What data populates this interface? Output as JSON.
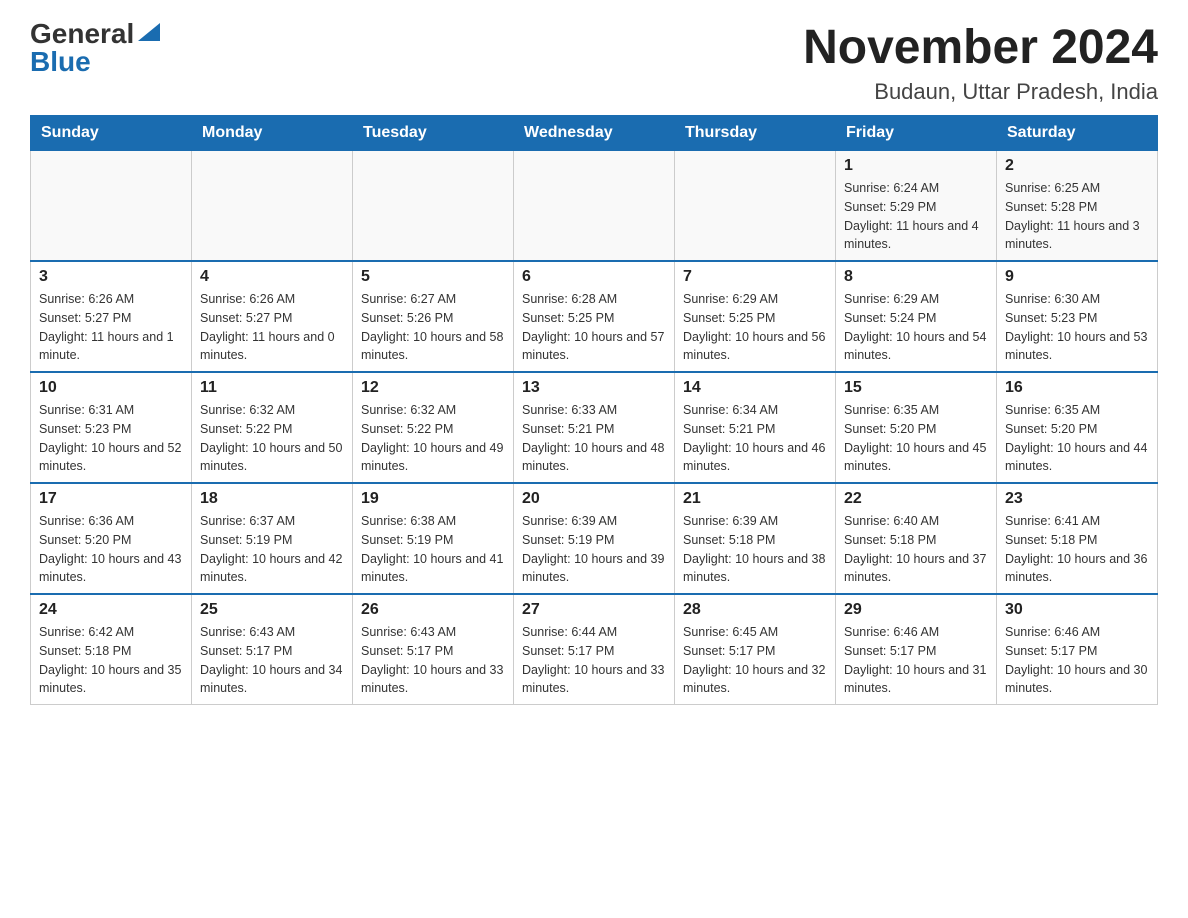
{
  "header": {
    "logo": {
      "general": "General",
      "blue": "Blue"
    },
    "title": "November 2024",
    "subtitle": "Budaun, Uttar Pradesh, India"
  },
  "days_of_week": [
    "Sunday",
    "Monday",
    "Tuesday",
    "Wednesday",
    "Thursday",
    "Friday",
    "Saturday"
  ],
  "weeks": [
    [
      {
        "day": "",
        "info": ""
      },
      {
        "day": "",
        "info": ""
      },
      {
        "day": "",
        "info": ""
      },
      {
        "day": "",
        "info": ""
      },
      {
        "day": "",
        "info": ""
      },
      {
        "day": "1",
        "info": "Sunrise: 6:24 AM\nSunset: 5:29 PM\nDaylight: 11 hours and 4 minutes."
      },
      {
        "day": "2",
        "info": "Sunrise: 6:25 AM\nSunset: 5:28 PM\nDaylight: 11 hours and 3 minutes."
      }
    ],
    [
      {
        "day": "3",
        "info": "Sunrise: 6:26 AM\nSunset: 5:27 PM\nDaylight: 11 hours and 1 minute."
      },
      {
        "day": "4",
        "info": "Sunrise: 6:26 AM\nSunset: 5:27 PM\nDaylight: 11 hours and 0 minutes."
      },
      {
        "day": "5",
        "info": "Sunrise: 6:27 AM\nSunset: 5:26 PM\nDaylight: 10 hours and 58 minutes."
      },
      {
        "day": "6",
        "info": "Sunrise: 6:28 AM\nSunset: 5:25 PM\nDaylight: 10 hours and 57 minutes."
      },
      {
        "day": "7",
        "info": "Sunrise: 6:29 AM\nSunset: 5:25 PM\nDaylight: 10 hours and 56 minutes."
      },
      {
        "day": "8",
        "info": "Sunrise: 6:29 AM\nSunset: 5:24 PM\nDaylight: 10 hours and 54 minutes."
      },
      {
        "day": "9",
        "info": "Sunrise: 6:30 AM\nSunset: 5:23 PM\nDaylight: 10 hours and 53 minutes."
      }
    ],
    [
      {
        "day": "10",
        "info": "Sunrise: 6:31 AM\nSunset: 5:23 PM\nDaylight: 10 hours and 52 minutes."
      },
      {
        "day": "11",
        "info": "Sunrise: 6:32 AM\nSunset: 5:22 PM\nDaylight: 10 hours and 50 minutes."
      },
      {
        "day": "12",
        "info": "Sunrise: 6:32 AM\nSunset: 5:22 PM\nDaylight: 10 hours and 49 minutes."
      },
      {
        "day": "13",
        "info": "Sunrise: 6:33 AM\nSunset: 5:21 PM\nDaylight: 10 hours and 48 minutes."
      },
      {
        "day": "14",
        "info": "Sunrise: 6:34 AM\nSunset: 5:21 PM\nDaylight: 10 hours and 46 minutes."
      },
      {
        "day": "15",
        "info": "Sunrise: 6:35 AM\nSunset: 5:20 PM\nDaylight: 10 hours and 45 minutes."
      },
      {
        "day": "16",
        "info": "Sunrise: 6:35 AM\nSunset: 5:20 PM\nDaylight: 10 hours and 44 minutes."
      }
    ],
    [
      {
        "day": "17",
        "info": "Sunrise: 6:36 AM\nSunset: 5:20 PM\nDaylight: 10 hours and 43 minutes."
      },
      {
        "day": "18",
        "info": "Sunrise: 6:37 AM\nSunset: 5:19 PM\nDaylight: 10 hours and 42 minutes."
      },
      {
        "day": "19",
        "info": "Sunrise: 6:38 AM\nSunset: 5:19 PM\nDaylight: 10 hours and 41 minutes."
      },
      {
        "day": "20",
        "info": "Sunrise: 6:39 AM\nSunset: 5:19 PM\nDaylight: 10 hours and 39 minutes."
      },
      {
        "day": "21",
        "info": "Sunrise: 6:39 AM\nSunset: 5:18 PM\nDaylight: 10 hours and 38 minutes."
      },
      {
        "day": "22",
        "info": "Sunrise: 6:40 AM\nSunset: 5:18 PM\nDaylight: 10 hours and 37 minutes."
      },
      {
        "day": "23",
        "info": "Sunrise: 6:41 AM\nSunset: 5:18 PM\nDaylight: 10 hours and 36 minutes."
      }
    ],
    [
      {
        "day": "24",
        "info": "Sunrise: 6:42 AM\nSunset: 5:18 PM\nDaylight: 10 hours and 35 minutes."
      },
      {
        "day": "25",
        "info": "Sunrise: 6:43 AM\nSunset: 5:17 PM\nDaylight: 10 hours and 34 minutes."
      },
      {
        "day": "26",
        "info": "Sunrise: 6:43 AM\nSunset: 5:17 PM\nDaylight: 10 hours and 33 minutes."
      },
      {
        "day": "27",
        "info": "Sunrise: 6:44 AM\nSunset: 5:17 PM\nDaylight: 10 hours and 33 minutes."
      },
      {
        "day": "28",
        "info": "Sunrise: 6:45 AM\nSunset: 5:17 PM\nDaylight: 10 hours and 32 minutes."
      },
      {
        "day": "29",
        "info": "Sunrise: 6:46 AM\nSunset: 5:17 PM\nDaylight: 10 hours and 31 minutes."
      },
      {
        "day": "30",
        "info": "Sunrise: 6:46 AM\nSunset: 5:17 PM\nDaylight: 10 hours and 30 minutes."
      }
    ]
  ]
}
